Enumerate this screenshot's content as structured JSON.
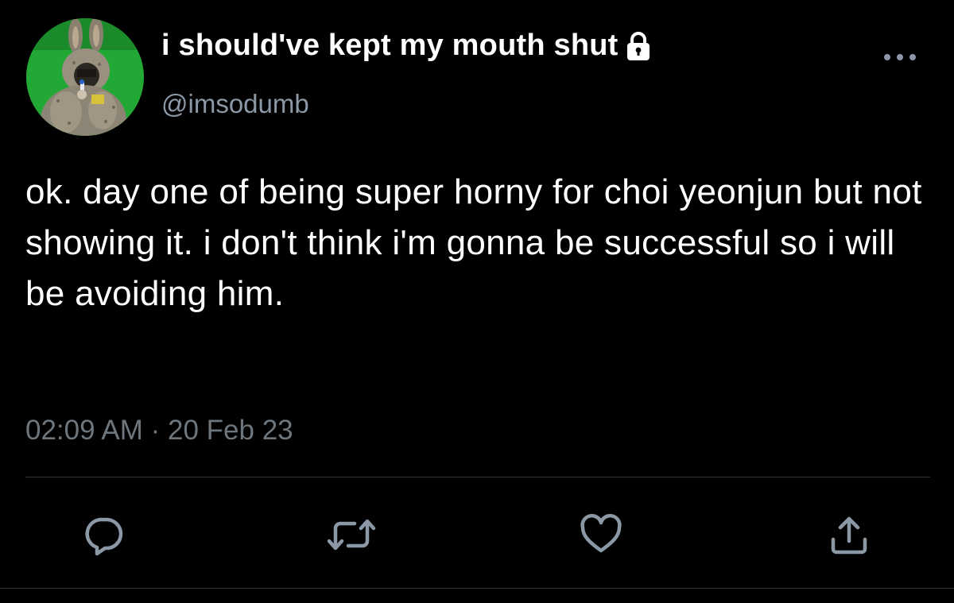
{
  "tweet": {
    "display_name": "i should've kept my mouth shut",
    "handle": "@imsodumb",
    "text": "ok. day one of being super horny for choi yeonjun but not showing it. i don't think i'm gonna be successful so i will be avoiding him.",
    "time": "02:09 AM",
    "separator": " · ",
    "date": "20 Feb 23"
  },
  "icons": {
    "lock": "lock-icon",
    "more": "more-options-icon",
    "reply": "reply-icon",
    "retweet": "retweet-icon",
    "like": "heart-icon",
    "share": "share-icon"
  },
  "colors": {
    "background": "#000000",
    "text_primary": "#ffffff",
    "text_secondary": "#8b98a5",
    "divider": "#2f3336",
    "icon": "#8b98a5"
  }
}
